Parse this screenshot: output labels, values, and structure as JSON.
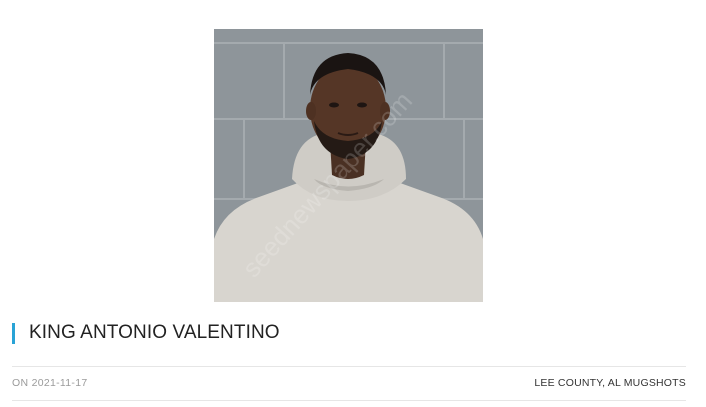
{
  "post": {
    "title": "KING ANTONIO VALENTINO",
    "date": "ON 2021-11-17",
    "category": "LEE COUNTY, AL MUGSHOTS",
    "photo_watermark": "seednewspaper.com"
  },
  "colors": {
    "accent": "#29a3d6",
    "photo_wall": "#8f969b",
    "hoodie": "#d9d6d0"
  }
}
